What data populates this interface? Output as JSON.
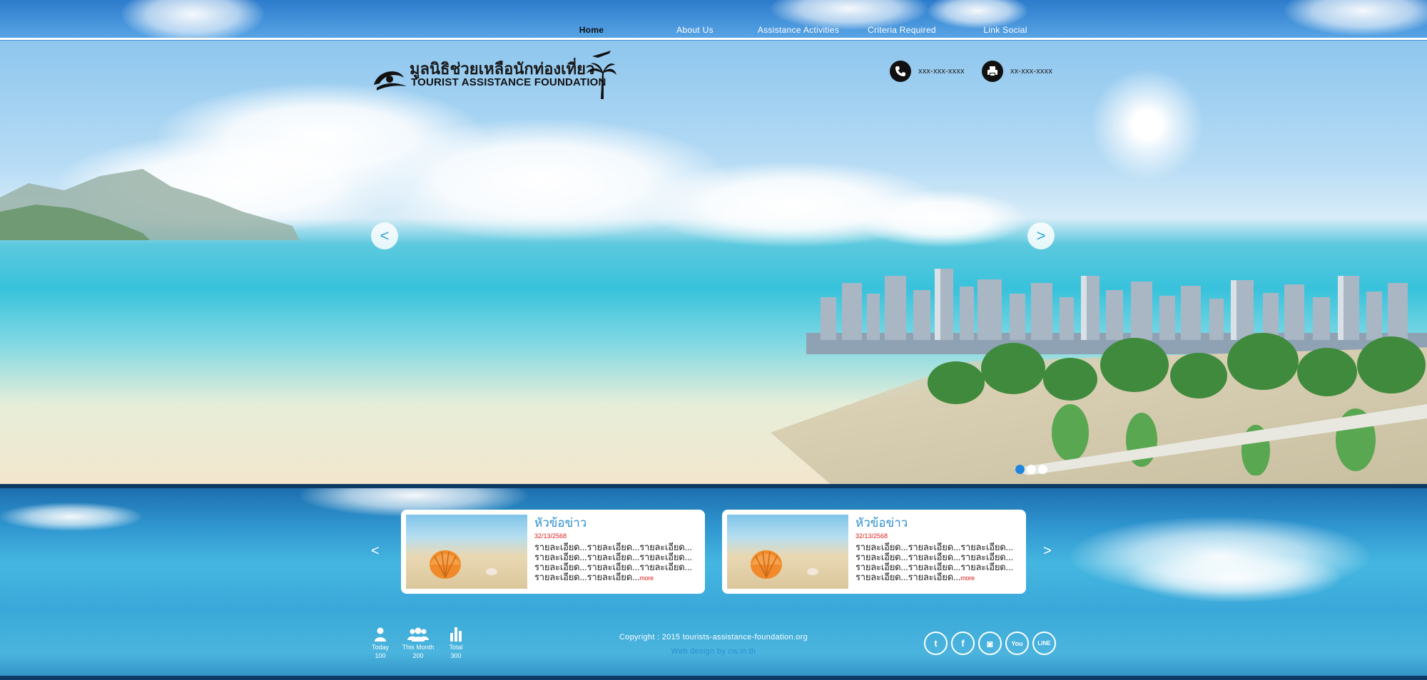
{
  "nav": {
    "tabs": [
      {
        "label": "Home",
        "active": true
      },
      {
        "label": "About  Us",
        "active": false
      },
      {
        "label": "Assistance  Activities",
        "active": false
      },
      {
        "label": "Criteria  Required",
        "active": false
      },
      {
        "label": "Link  Social",
        "active": false
      }
    ]
  },
  "header": {
    "logo_th": "มูลนิธิช่วยเหลือนักท่องเที่ยว",
    "logo_en": "TOURIST ASSISTANCE FOUNDATION",
    "phone": "xxx-xxx-xxxx",
    "fax": "xx-xxx-xxxx"
  },
  "slider": {
    "prev": "<",
    "next": ">",
    "dots": 3,
    "active_dot": 0
  },
  "news": {
    "prev": "<",
    "next": ">",
    "cards": [
      {
        "title": "หัวข้อข่าว",
        "date": "32/13/2568",
        "lines": [
          "รายละเอียด...รายละเอียด...รายละเอียด...",
          "รายละเอียด...รายละเอียด...รายละเอียด...",
          "รายละเอียด...รายละเอียด...รายละเอียด...",
          "รายละเอียด...รายละเอียด..."
        ],
        "more": "more"
      },
      {
        "title": "หัวข้อข่าว",
        "date": "32/13/2568",
        "lines": [
          "รายละเอียด...รายละเอียด...รายละเอียด...",
          "รายละเอียด...รายละเอียด...รายละเอียด...",
          "รายละเอียด...รายละเอียด...รายละเอียด...",
          "รายละเอียด...รายละเอียด..."
        ],
        "more": "more"
      }
    ]
  },
  "footer": {
    "stats": [
      {
        "label": "Today",
        "value": "100",
        "icon": "person-icon"
      },
      {
        "label": "This Month",
        "value": "200",
        "icon": "group-icon"
      },
      {
        "label": "Total",
        "value": "300",
        "icon": "bar-chart-icon"
      }
    ],
    "copyright": "Copyright  :  2015  tourists-assistance-foundation.org",
    "credit": "Web  design  by  cw.in.th",
    "social": [
      {
        "name": "twitter",
        "glyph": "t"
      },
      {
        "name": "facebook",
        "glyph": "f"
      },
      {
        "name": "instagram",
        "glyph": "◙"
      },
      {
        "name": "youtube",
        "glyph": "You"
      },
      {
        "name": "line",
        "glyph": "LINE"
      }
    ]
  },
  "colors": {
    "accent": "#2a8ed0",
    "date_red": "#e01c1c",
    "dot_active": "#1f86e0",
    "dark_band": "#0e3b66"
  }
}
